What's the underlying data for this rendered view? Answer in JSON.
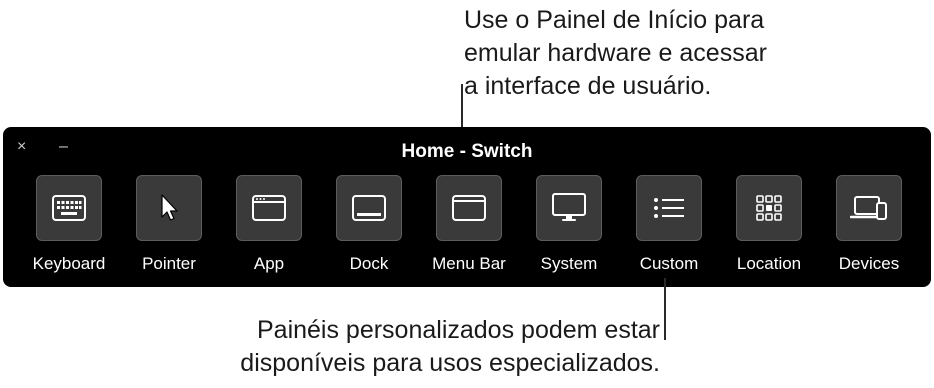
{
  "callouts": {
    "top": [
      "Use o Painel de Início para",
      "emular hardware e acessar",
      "a interface de usuário."
    ],
    "bottom": [
      "Painéis personalizados podem estar",
      "disponíveis para usos especializados."
    ]
  },
  "panel": {
    "title": "Home - Switch",
    "close_label": "×",
    "minimize_label": "–"
  },
  "buttons": [
    {
      "label": "Keyboard",
      "icon": "keyboard-icon"
    },
    {
      "label": "Pointer",
      "icon": "pointer-icon"
    },
    {
      "label": "App",
      "icon": "app-window-icon"
    },
    {
      "label": "Dock",
      "icon": "dock-icon"
    },
    {
      "label": "Menu Bar",
      "icon": "menu-bar-icon"
    },
    {
      "label": "System",
      "icon": "display-icon"
    },
    {
      "label": "Custom",
      "icon": "list-icon"
    },
    {
      "label": "Location",
      "icon": "grid-icon"
    },
    {
      "label": "Devices",
      "icon": "devices-icon"
    }
  ],
  "colors": {
    "panel_bg": "#000000",
    "tile_bg": "#3a3a3a",
    "tile_border": "#5c5c5c",
    "text": "#ffffff"
  }
}
